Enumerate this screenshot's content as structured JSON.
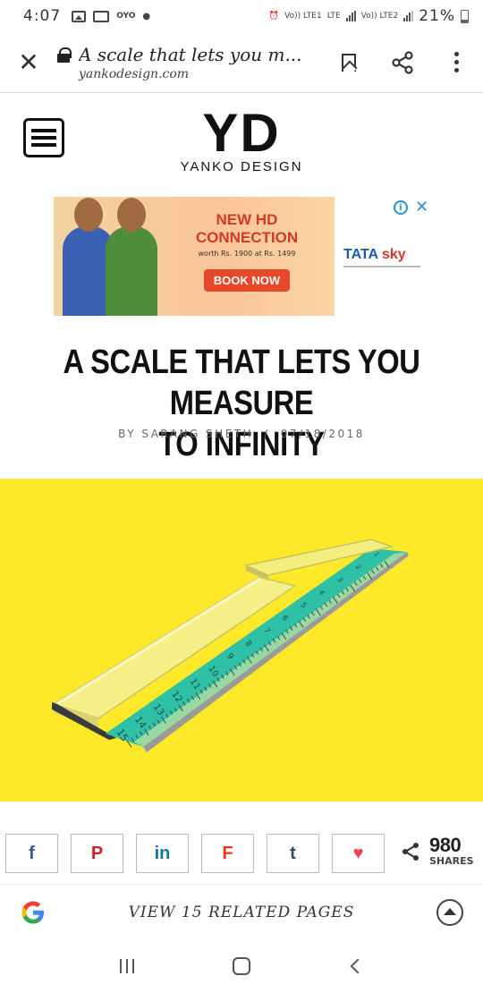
{
  "status_bar": {
    "time": "4:07",
    "app_badge": "OYO",
    "network_1": "Vo)) LTE1",
    "network_type": "LTE",
    "network_2": "Vo)) LTE2",
    "battery": "21%"
  },
  "browser": {
    "page_title": "A scale that lets you m...",
    "domain": "yankodesign.com"
  },
  "site": {
    "logo_mark": "YD",
    "logo_name": "YANKO DESIGN"
  },
  "ad": {
    "headline_1": "NEW HD",
    "headline_2": "CONNECTION",
    "price_text": "worth Rs. 1900 at Rs. 1499",
    "cta": "BOOK NOW",
    "brand_1": "TATA",
    "brand_2": "sky"
  },
  "article": {
    "title_line_1": "A SCALE THAT LETS YOU MEASURE",
    "title_line_2": "TO INFINITY",
    "author": "BY SARANG SHETH",
    "separator": "/",
    "date": "07/18/2018"
  },
  "hero": {
    "ruler_numbers": [
      "15",
      "14",
      "13",
      "12",
      "11",
      "10",
      "9",
      "8",
      "7",
      "6",
      "5",
      "4",
      "3",
      "2",
      "1"
    ],
    "colors": {
      "background": "#fde92a",
      "ruler": "#2ec1a6"
    }
  },
  "share": {
    "buttons": [
      {
        "label": "f",
        "color": "#3b5998"
      },
      {
        "label": "P",
        "color": "#cb2027"
      },
      {
        "label": "in",
        "color": "#0e76a8"
      },
      {
        "label": "F",
        "color": "#f5311c"
      },
      {
        "label": "t",
        "color": "#35465c"
      },
      {
        "label": "♥",
        "color": "#ef4056"
      }
    ],
    "count": "980",
    "count_label": "SHARES"
  },
  "related": {
    "label": "VIEW 15 RELATED PAGES"
  }
}
